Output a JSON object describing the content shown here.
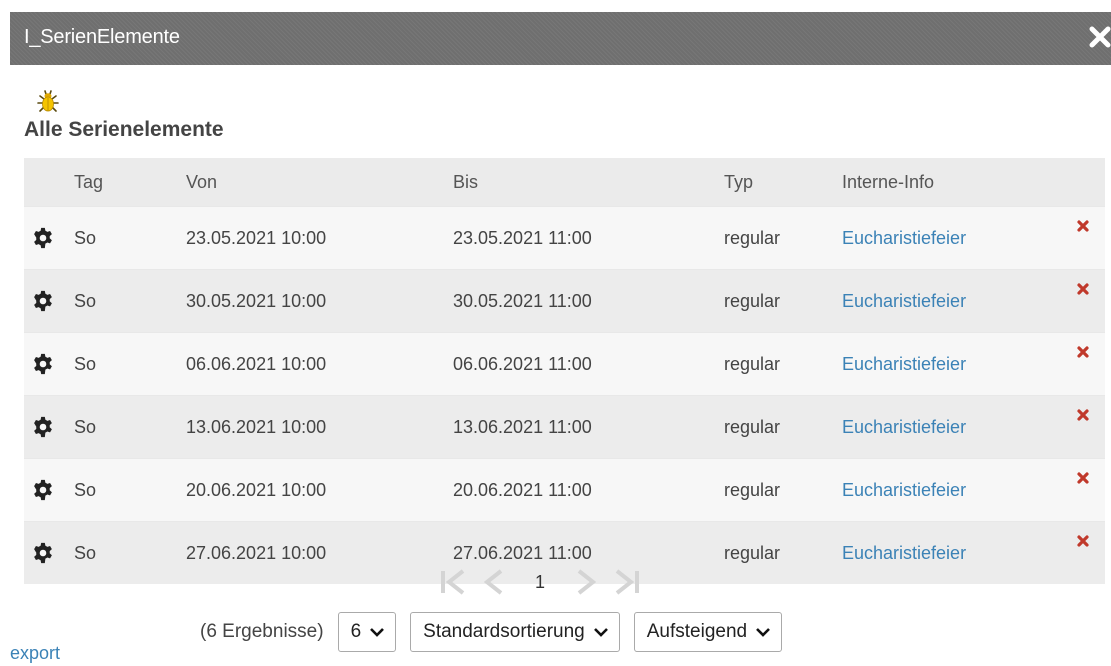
{
  "window": {
    "title": "I_SerienElemente"
  },
  "section": {
    "heading": "Alle Serienelemente"
  },
  "table": {
    "headers": [
      "Tag",
      "Von",
      "Bis",
      "Typ",
      "Interne-Info"
    ],
    "rows": [
      {
        "tag": "So",
        "von": "23.05.2021 10:00",
        "bis": "23.05.2021 11:00",
        "typ": "regular",
        "info": "Eucharistiefeier"
      },
      {
        "tag": "So",
        "von": "30.05.2021 10:00",
        "bis": "30.05.2021 11:00",
        "typ": "regular",
        "info": "Eucharistiefeier"
      },
      {
        "tag": "So",
        "von": "06.06.2021 10:00",
        "bis": "06.06.2021 11:00",
        "typ": "regular",
        "info": "Eucharistiefeier"
      },
      {
        "tag": "So",
        "von": "13.06.2021 10:00",
        "bis": "13.06.2021 11:00",
        "typ": "regular",
        "info": "Eucharistiefeier"
      },
      {
        "tag": "So",
        "von": "20.06.2021 10:00",
        "bis": "20.06.2021 11:00",
        "typ": "regular",
        "info": "Eucharistiefeier"
      },
      {
        "tag": "So",
        "von": "27.06.2021 10:00",
        "bis": "27.06.2021 11:00",
        "typ": "regular",
        "info": "Eucharistiefeier"
      }
    ]
  },
  "pagination": {
    "current_page": "1"
  },
  "controls": {
    "result_count": "(6 Ergebnisse)",
    "page_size": "6",
    "sort_order": "Standardsortierung",
    "direction": "Aufsteigend"
  },
  "footer": {
    "export_label": "export"
  },
  "colors": {
    "link": "#3b82b6",
    "titlebar": "#6f6f6f",
    "delete": "#c0392b"
  },
  "icons": [
    "close-icon",
    "bug-icon",
    "gear-icon",
    "delete-icon",
    "first-page-icon",
    "prev-page-icon",
    "next-page-icon",
    "last-page-icon",
    "chevron-down-icon"
  ]
}
